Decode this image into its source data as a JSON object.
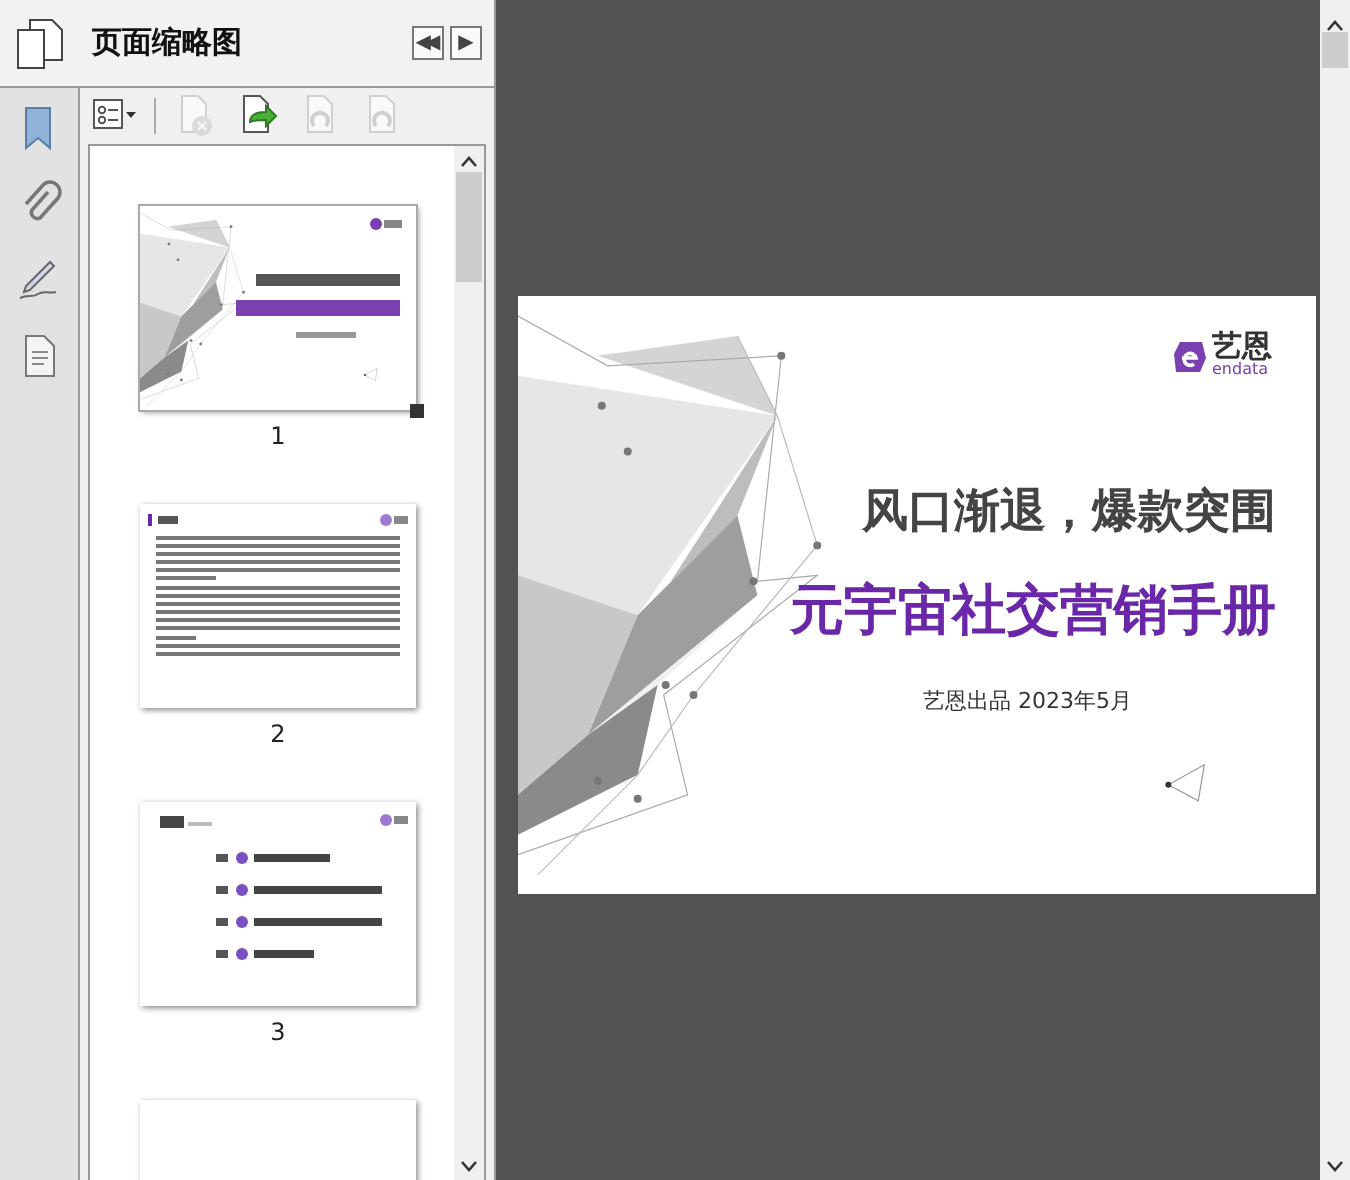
{
  "panel": {
    "title": "页面缩略图",
    "nav_buttons": [
      "◀◀",
      "▶"
    ]
  },
  "toolbar": [
    {
      "kind": "options",
      "disabled": false
    },
    {
      "kind": "delete",
      "disabled": true
    },
    {
      "kind": "insert",
      "disabled": false
    },
    {
      "kind": "rotate-left",
      "disabled": true
    },
    {
      "kind": "rotate-right",
      "disabled": true
    }
  ],
  "side_icons": [
    {
      "kind": "bookmark"
    },
    {
      "kind": "attachment"
    },
    {
      "kind": "signature"
    },
    {
      "kind": "document"
    }
  ],
  "thumbnails": [
    {
      "kind": "cover",
      "label": "1",
      "selected": true
    },
    {
      "kind": "text",
      "label": "2",
      "selected": false
    },
    {
      "kind": "toc",
      "label": "3",
      "selected": false
    },
    {
      "kind": "blank",
      "selected": false
    }
  ],
  "slide": {
    "logo_text": "艺恩",
    "logo_sub": "endata",
    "heading": "风口渐退，爆款突围",
    "title": "元宇宙社交营销手册",
    "byline": "艺恩出品 2023年5月"
  }
}
